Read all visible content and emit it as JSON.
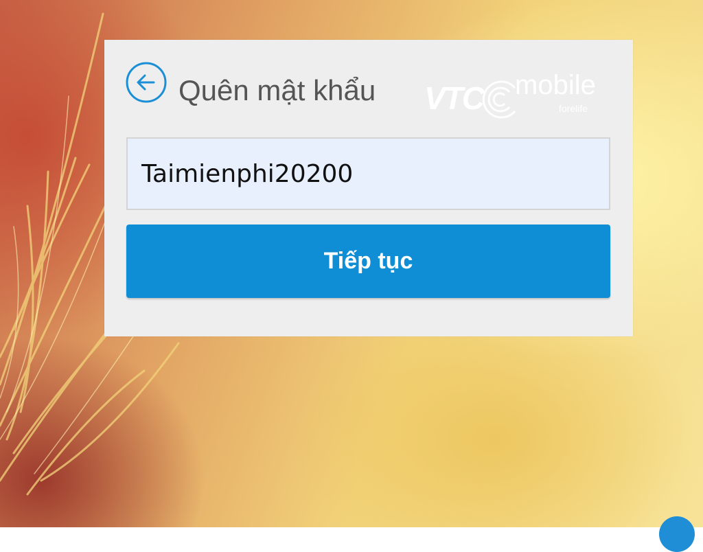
{
  "form": {
    "title": "Quên mật khẩu",
    "username_value": "Taimienphi20200",
    "continue_label": "Tiếp tục"
  },
  "logo": {
    "vtc": "VTC",
    "mobile": "mobile",
    "tagline": "forelife"
  },
  "icons": {
    "back": "arrow-left-circle-icon"
  },
  "colors": {
    "accent": "#0f8ed5",
    "panel": "#eeeeee",
    "input_bg": "#e8f0fe",
    "title": "#555555"
  }
}
